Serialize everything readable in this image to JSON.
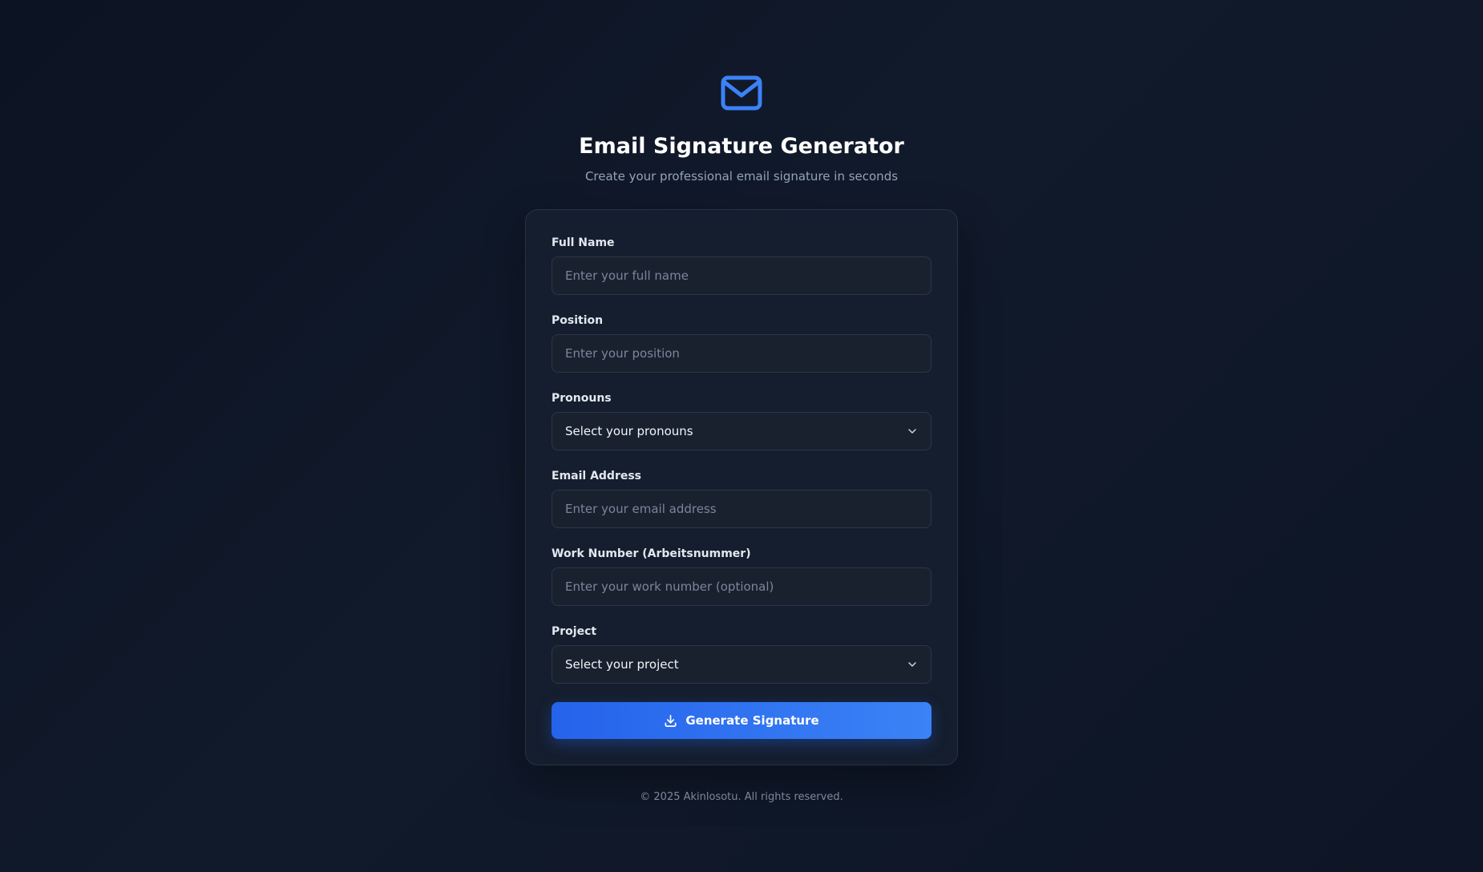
{
  "header": {
    "logo_icon": "mail-icon",
    "title": "Email Signature Generator",
    "subtitle": "Create your professional email signature in seconds"
  },
  "form": {
    "full_name": {
      "label": "Full Name",
      "placeholder": "Enter your full name",
      "value": ""
    },
    "position": {
      "label": "Position",
      "placeholder": "Enter your position",
      "value": ""
    },
    "pronouns": {
      "label": "Pronouns",
      "selected": "Select your pronouns",
      "icon": "chevron-down-icon"
    },
    "email": {
      "label": "Email Address",
      "placeholder": "Enter your email address",
      "value": ""
    },
    "work_number": {
      "label": "Work Number (Arbeitsnummer)",
      "placeholder": "Enter your work number (optional)",
      "value": ""
    },
    "project": {
      "label": "Project",
      "selected": "Select your project",
      "icon": "chevron-down-icon"
    },
    "submit": {
      "label": "Generate Signature",
      "icon": "download-icon"
    }
  },
  "footer": {
    "copyright": "© 2025 Akinlosotu. All rights reserved."
  },
  "colors": {
    "accent": "#3b82f6",
    "button_start": "#2563eb",
    "button_end": "#3b82f6",
    "background": "#0f1727",
    "card": "#151e2e"
  }
}
